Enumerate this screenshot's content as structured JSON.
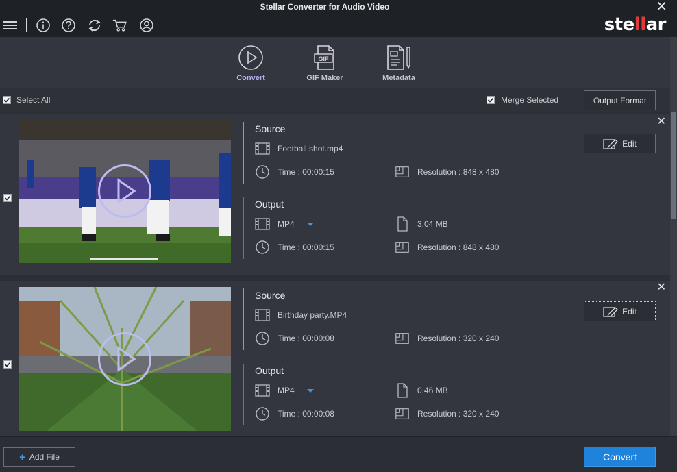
{
  "window": {
    "title": "Stellar Converter for Audio Video",
    "close_glyph": "✕"
  },
  "logo": {
    "text_before": "ste",
    "text_red": "ll",
    "text_after": "ar"
  },
  "toolbar": {
    "icons": [
      "hamburger-menu-icon",
      "info-icon",
      "help-icon",
      "update-icon",
      "cart-icon",
      "account-icon"
    ]
  },
  "modes": [
    {
      "label": "Convert",
      "icon": "play-circle-icon",
      "active": true
    },
    {
      "label": "GIF Maker",
      "icon": "gif-file-icon",
      "active": false
    },
    {
      "label": "Metadata",
      "icon": "metadata-icon",
      "active": false
    }
  ],
  "selection": {
    "select_all_label": "Select All",
    "merge_selected_label": "Merge Selected",
    "output_format_label": "Output Format"
  },
  "files": [
    {
      "source_title": "Source",
      "source_name": "Football shot.mp4",
      "source_time": "Time : 00:00:15",
      "source_resolution": "Resolution : 848 x 480",
      "output_title": "Output",
      "output_format": "MP4",
      "output_size": "3.04 MB",
      "output_time": "Time : 00:00:15",
      "output_resolution": "Resolution : 848 x 480",
      "edit_label": "Edit"
    },
    {
      "source_title": "Source",
      "source_name": "Birthday party.MP4",
      "source_time": "Time : 00:00:08",
      "source_resolution": "Resolution : 320 x 240",
      "output_title": "Output",
      "output_format": "MP4",
      "output_size": "0.46 MB",
      "output_time": "Time : 00:00:08",
      "output_resolution": "Resolution : 320 x 240",
      "edit_label": "Edit"
    }
  ],
  "footer": {
    "add_file_label": "Add File",
    "add_glyph": "+",
    "convert_label": "Convert"
  },
  "colors": {
    "accent_blue": "#1f82db",
    "source_orange": "#e7892d",
    "output_blue": "#2a88d8",
    "active_mode": "#b6b4f0",
    "logo_red": "#e03a3a"
  }
}
